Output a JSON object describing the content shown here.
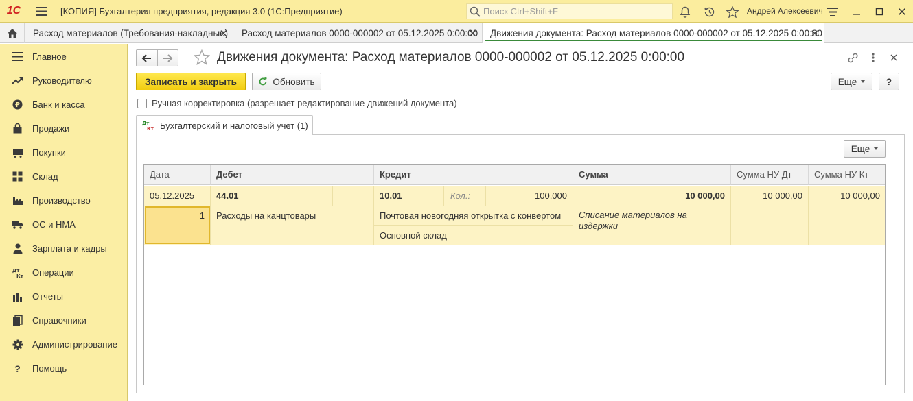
{
  "app": {
    "logo": "1С",
    "title": "[КОПИЯ] Бухгалтерия предприятия, редакция 3.0  (1С:Предприятие)",
    "search_placeholder": "Поиск Ctrl+Shift+F",
    "user": "Андрей Алексеевич"
  },
  "tabs": [
    {
      "label": "Расход материалов (Требования-накладные)",
      "active": false
    },
    {
      "label": "Расход материалов 0000-000002 от 05.12.2025 0:00:00",
      "active": false
    },
    {
      "label": "Движения документа: Расход материалов 0000-000002 от 05.12.2025 0:00:00",
      "active": true
    }
  ],
  "sidebar": {
    "items": [
      {
        "label": "Главное",
        "icon": "menu-lines-icon"
      },
      {
        "label": "Руководителю",
        "icon": "trend-icon"
      },
      {
        "label": "Банк и касса",
        "icon": "ruble-coin-icon"
      },
      {
        "label": "Продажи",
        "icon": "shopping-bag-icon"
      },
      {
        "label": "Покупки",
        "icon": "cart-icon"
      },
      {
        "label": "Склад",
        "icon": "warehouse-icon"
      },
      {
        "label": "Производство",
        "icon": "factory-icon"
      },
      {
        "label": "ОС и НМА",
        "icon": "truck-icon"
      },
      {
        "label": "Зарплата и кадры",
        "icon": "person-icon"
      },
      {
        "label": "Операции",
        "icon": "dt-kt-icon"
      },
      {
        "label": "Отчеты",
        "icon": "bar-chart-icon"
      },
      {
        "label": "Справочники",
        "icon": "books-icon"
      },
      {
        "label": "Администрирование",
        "icon": "gear-icon"
      },
      {
        "label": "Помощь",
        "icon": "question-icon"
      }
    ]
  },
  "form": {
    "title": "Движения документа: Расход материалов 0000-000002 от 05.12.2025 0:00:00",
    "save_close": "Записать и закрыть",
    "refresh": "Обновить",
    "more": "Еще",
    "help": "?",
    "manual_correction": "Ручная корректировка (разрешает редактирование движений документа)",
    "manual_correction_checked": false,
    "inner_tab": "Бухгалтерский и налоговый учет (1)",
    "inner_tab_icon_top": "Дт",
    "inner_tab_icon_bottom": "Кт",
    "table_more": "Еще"
  },
  "table": {
    "headers": {
      "date": "Дата",
      "debit": "Дебет",
      "credit": "Кредит",
      "sum": "Сумма",
      "sum_nu_dt": "Сумма НУ Дт",
      "sum_nu_kt": "Сумма НУ Кт"
    },
    "row": {
      "date": "05.12.2025",
      "number": "1",
      "debit_account": "44.01",
      "debit_subconto1": "Расходы на канцтовары",
      "credit_account": "10.01",
      "credit_qty_label": "Кол.:",
      "credit_qty": "100,000",
      "credit_subconto1": "Почтовая новогодняя открытка с конвертом",
      "credit_subconto2": "Основной склад",
      "sum": "10 000,00",
      "content": "Списание материалов на издержки",
      "sum_nu_dt": "10 000,00",
      "sum_nu_kt": "10 000,00"
    }
  }
}
